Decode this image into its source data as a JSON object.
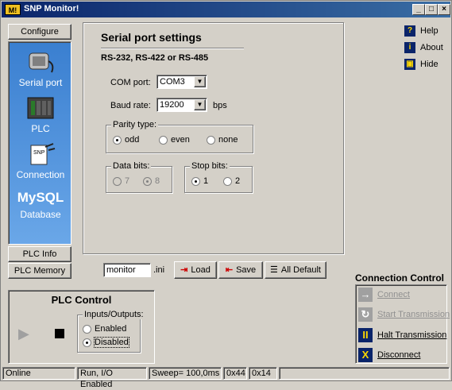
{
  "window": {
    "title": "SNP Monitor!",
    "icon_text": "M!"
  },
  "sidebar": {
    "configure_label": "Configure",
    "items": [
      {
        "label": "Serial port",
        "icon": "serial-port-icon"
      },
      {
        "label": "PLC",
        "icon": "plc-icon"
      },
      {
        "label": "Connection",
        "icon": "connection-icon"
      },
      {
        "label": "Database",
        "icon": "mysql-icon",
        "icon_text": "MySQL"
      }
    ],
    "plc_info_label": "PLC Info",
    "plc_memory_label": "PLC Memory"
  },
  "settings": {
    "title": "Serial port settings",
    "subtitle": "RS-232, RS-422 or RS-485",
    "com_port_label": "COM port:",
    "com_port_value": "COM3",
    "baud_rate_label": "Baud rate:",
    "baud_rate_value": "19200",
    "baud_unit": "bps",
    "parity": {
      "title": "Parity type:",
      "options": [
        "odd",
        "even",
        "none"
      ],
      "selected": "odd"
    },
    "data_bits": {
      "title": "Data bits:",
      "options": [
        "7",
        "8"
      ],
      "selected": "8"
    },
    "stop_bits": {
      "title": "Stop bits:",
      "options": [
        "1",
        "2"
      ],
      "selected": "1"
    }
  },
  "file_bar": {
    "filename": "monitor",
    "extension": ".ini",
    "load_label": "Load",
    "save_label": "Save",
    "default_label": "All Default"
  },
  "help_links": {
    "help": "Help",
    "about": "About",
    "hide": "Hide"
  },
  "plc_control": {
    "title": "PLC Control",
    "io_group": "Inputs/Outputs:",
    "enabled_label": "Enabled",
    "disabled_label": "Disabled",
    "selected": "Disabled"
  },
  "connection_control": {
    "title": "Connection Control",
    "connect": "Connect",
    "start": "Start Transmission",
    "halt": "Halt Transmission",
    "disconnect": "Disconnect"
  },
  "status_bar": {
    "state": "Online",
    "mode": "Run, I/O Enabled",
    "sweep": "Sweep= 100,0ms",
    "code1": "0x44",
    "code2": "0x14"
  },
  "colors": {
    "title_start": "#0a246a",
    "title_end": "#3a6ea5",
    "sidebar_top": "#3a7fd0",
    "sidebar_bottom": "#6aa7e8"
  }
}
